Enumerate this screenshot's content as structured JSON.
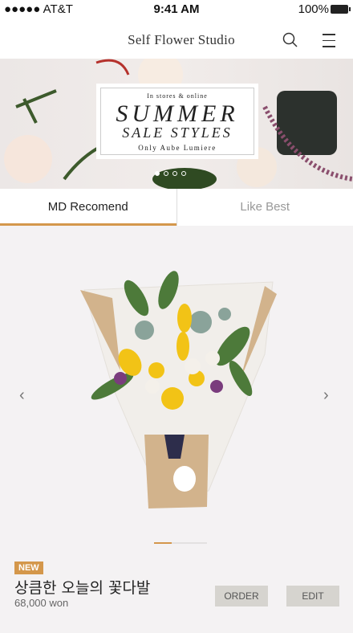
{
  "status": {
    "carrier": "●●●●● AT&T",
    "time": "9:41 AM",
    "battery": "100%"
  },
  "header": {
    "title": "Self  Flower Studio",
    "icons": [
      "search-icon",
      "menu-icon"
    ]
  },
  "banner": {
    "line1": "In stores & online",
    "line2": "SUMMER",
    "line3": "SALE STYLES",
    "line4": "Only Aube Lumiere",
    "slides": 4,
    "active_slide": 1
  },
  "tabs": [
    {
      "label": "MD Recomend",
      "active": true
    },
    {
      "label": "Like Best",
      "active": false
    }
  ],
  "product": {
    "badge": "NEW",
    "name": "상큼한 오늘의 꽃다발",
    "price": "68,000 won",
    "order_label": "ORDER",
    "edit_label": "EDIT",
    "prev": "‹",
    "next": "›",
    "pager_progress": 0.33
  },
  "colors": {
    "accent": "#d4974b",
    "button": "#d6d4cf"
  }
}
